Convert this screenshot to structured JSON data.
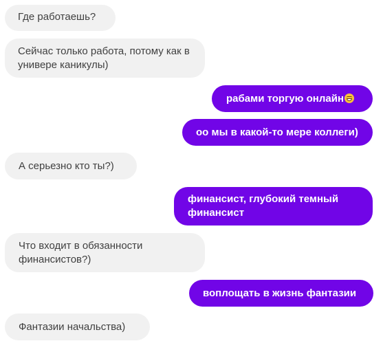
{
  "messages": [
    {
      "side": "in",
      "text": "Где работаешь?"
    },
    {
      "side": "in",
      "text": "Сейчас только работа, потому как в универе каникулы)"
    },
    {
      "side": "out",
      "text": "рабами торгую онлайн",
      "emoji": "grinning-face-emoji"
    },
    {
      "side": "out",
      "text": "оо мы в какой-то мере коллеги)"
    },
    {
      "side": "in",
      "text": "А серьезно кто ты?)"
    },
    {
      "side": "out",
      "text": "финансист, глубокий темный финансист"
    },
    {
      "side": "in",
      "text": "Что входит в обязанности финансистов?)"
    },
    {
      "side": "out",
      "text": "воплощать в жизнь фантазии"
    },
    {
      "side": "in",
      "text": "Фантазии начальства)"
    }
  ],
  "colors": {
    "incoming_bg": "#f1f1f1",
    "incoming_text": "#404040",
    "outgoing_bg": "#7105e7",
    "outgoing_text": "#ffffff"
  }
}
